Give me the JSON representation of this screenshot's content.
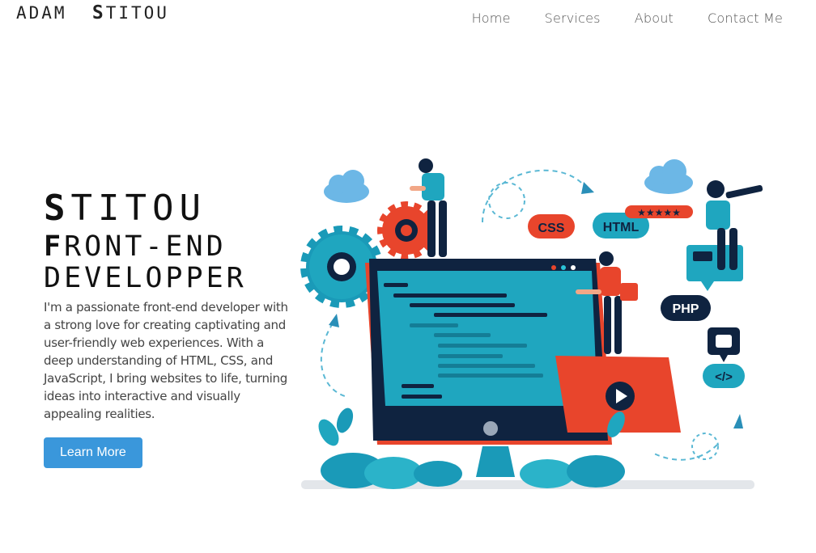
{
  "header": {
    "logo_first": "ADAM",
    "logo_initial": "S",
    "logo_last": "TITOU",
    "nav": [
      {
        "label": "Home"
      },
      {
        "label": "Services"
      },
      {
        "label": "About"
      },
      {
        "label": "Contact Me"
      }
    ]
  },
  "hero": {
    "title_initial": "S",
    "title_rest": "TITOU",
    "subtitle_initial": "F",
    "subtitle_rest": "RONT-END",
    "subtitle_line2": "DEVELOPPER",
    "description": "I'm a passionate front-end developer with a strong love for creating captivating and user-friendly web experiences. With a deep understanding of HTML, CSS, and JavaScript, I bring websites to life, turning ideas into interactive and visually appealing realities.",
    "cta_label": "Learn More"
  },
  "illustration": {
    "tags": {
      "css": "CSS",
      "html": "HTML",
      "php": "PHP",
      "code": "</>"
    },
    "rating_stars": "★★★★★"
  },
  "colors": {
    "accent_blue": "#3a97db",
    "teal": "#1fa6bf",
    "orange_red": "#e8452c",
    "navy": "#0f2340"
  }
}
